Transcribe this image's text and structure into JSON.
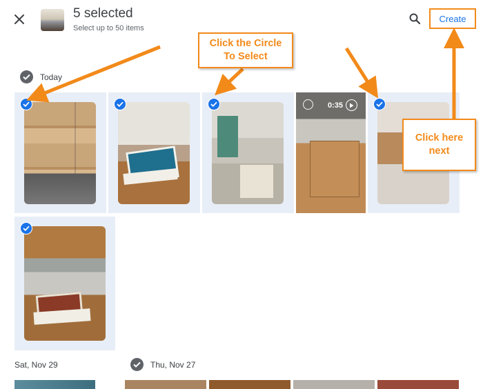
{
  "header": {
    "close_icon": "close-icon",
    "selected_title": "5 selected",
    "selection_limit": "Select up to 50 items",
    "search_icon": "search-icon",
    "create_label": "Create"
  },
  "sections": {
    "today": {
      "label": "Today"
    },
    "sat": {
      "label": "Sat, Nov 29"
    },
    "thu": {
      "label": "Thu, Nov 27"
    }
  },
  "photos": {
    "video_duration": "0:35",
    "selected_count": 5,
    "items": [
      {
        "name": "photo-boxes-cart",
        "selected": true
      },
      {
        "name": "photo-book-stack",
        "selected": true
      },
      {
        "name": "photo-shelves-desk",
        "selected": true
      },
      {
        "name": "video-packing-boxes",
        "selected": false
      },
      {
        "name": "photo-library-aisle",
        "selected": true
      },
      {
        "name": "photo-book-stack-2",
        "selected": true
      }
    ]
  },
  "annotations": {
    "circle_callout_line1": "Click the Circle",
    "circle_callout_line2": "To Select",
    "create_callout_line1": "Click here",
    "create_callout_line2": "next",
    "accent_color": "#f28a1a"
  },
  "colors": {
    "brand_blue": "#1a73e8",
    "selected_tile_bg": "#e8eef7"
  }
}
